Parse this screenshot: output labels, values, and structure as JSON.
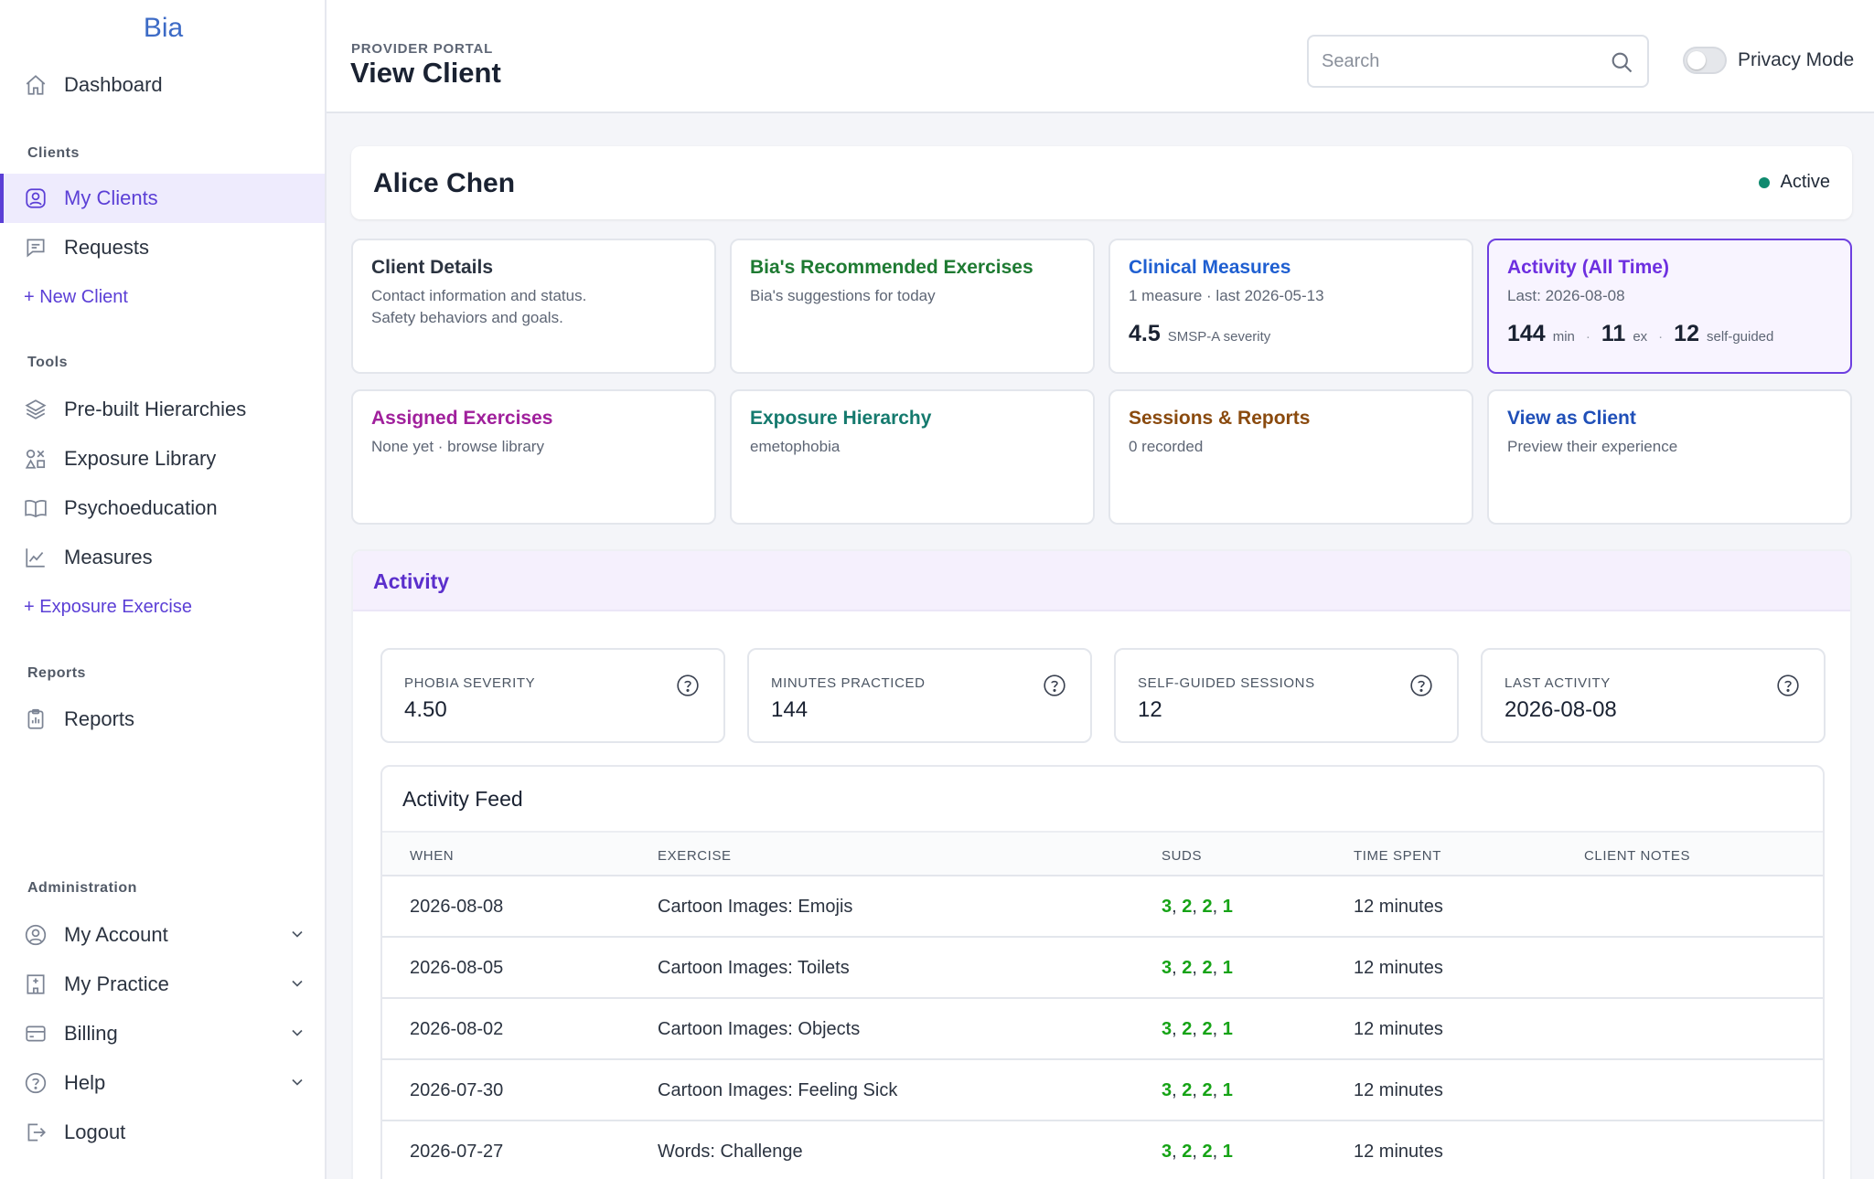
{
  "app": {
    "brand": "Bia"
  },
  "sidebar": {
    "dashboard": "Dashboard",
    "sections": {
      "clients": "Clients",
      "tools": "Tools",
      "reports": "Reports",
      "administration": "Administration"
    },
    "clients_items": [
      "My Clients",
      "Requests",
      "+ New Client"
    ],
    "tools_items": [
      "Pre-built Hierarchies",
      "Exposure Library",
      "Psychoeducation",
      "Measures",
      "+ Exposure Exercise"
    ],
    "reports_items": [
      "Reports"
    ],
    "admin_items": [
      "My Account",
      "My Practice",
      "Billing",
      "Help",
      "Logout"
    ]
  },
  "header": {
    "eyebrow": "PROVIDER PORTAL",
    "title": "View Client",
    "search_placeholder": "Search",
    "privacy_label": "Privacy Mode",
    "privacy_on": false
  },
  "client": {
    "name": "Alice Chen",
    "status": "Active",
    "status_color": "#0f8a6f"
  },
  "tiles": [
    {
      "title": "Client Details",
      "color": "#2b3340",
      "sub1": "Contact information and status.",
      "sub2": "Safety behaviors and goals."
    },
    {
      "title": "Bia's Recommended Exercises",
      "color": "#1e7a32",
      "sub1": "Bia's suggestions for today"
    },
    {
      "title": "Clinical Measures",
      "color": "#1f5fd1",
      "sub1": "1 measure · last 2026-05-13",
      "stat_value": "4.5",
      "stat_unit": "SMSP-A severity"
    },
    {
      "title": "Activity (All Time)",
      "color": "#6d2fe0",
      "sub1": "Last: 2026-08-08",
      "min": "144",
      "min_unit": "min",
      "ex": "11",
      "ex_unit": "ex",
      "sg": "12",
      "sg_unit": "self-guided"
    },
    {
      "title": "Assigned Exercises",
      "color": "#a0209c",
      "sub1": "None yet · browse library"
    },
    {
      "title": "Exposure Hierarchy",
      "color": "#157a6e",
      "sub1": "emetophobia"
    },
    {
      "title": "Sessions & Reports",
      "color": "#8a4a0e",
      "sub1": "0 recorded"
    },
    {
      "title": "View as Client",
      "color": "#1f4fb8",
      "sub1": "Preview their experience"
    }
  ],
  "activity": {
    "title": "Activity",
    "stats": [
      {
        "label": "PHOBIA SEVERITY",
        "value": "4.50"
      },
      {
        "label": "MINUTES PRACTICED",
        "value": "144"
      },
      {
        "label": "SELF-GUIDED SESSIONS",
        "value": "12"
      },
      {
        "label": "LAST ACTIVITY",
        "value": "2026-08-08"
      }
    ],
    "feed": {
      "title": "Activity Feed",
      "columns": [
        "WHEN",
        "EXERCISE",
        "SUDS",
        "TIME SPENT",
        "CLIENT NOTES"
      ],
      "rows": [
        {
          "when": "2026-08-08",
          "exercise": "Cartoon Images: Emojis",
          "suds": [
            "3",
            "2",
            "2",
            "1"
          ],
          "time": "12 minutes",
          "notes": ""
        },
        {
          "when": "2026-08-05",
          "exercise": "Cartoon Images: Toilets",
          "suds": [
            "3",
            "2",
            "2",
            "1"
          ],
          "time": "12 minutes",
          "notes": ""
        },
        {
          "when": "2026-08-02",
          "exercise": "Cartoon Images: Objects",
          "suds": [
            "3",
            "2",
            "2",
            "1"
          ],
          "time": "12 minutes",
          "notes": ""
        },
        {
          "when": "2026-07-30",
          "exercise": "Cartoon Images: Feeling Sick",
          "suds": [
            "3",
            "2",
            "2",
            "1"
          ],
          "time": "12 minutes",
          "notes": ""
        },
        {
          "when": "2026-07-27",
          "exercise": "Words: Challenge",
          "suds": [
            "3",
            "2",
            "2",
            "1"
          ],
          "time": "12 minutes",
          "notes": ""
        }
      ]
    }
  },
  "colors": {
    "accent": "#5b3fd6",
    "suds_green": "#16a316"
  }
}
